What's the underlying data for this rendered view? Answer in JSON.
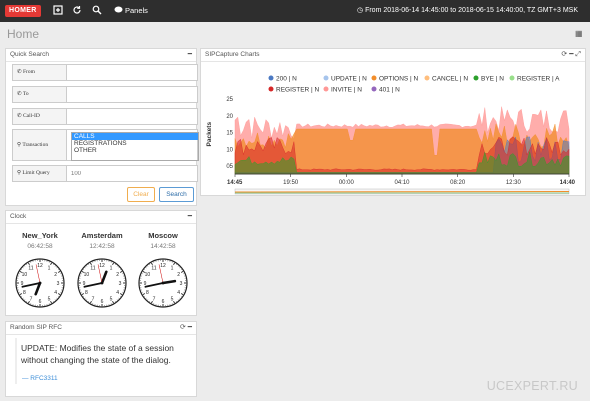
{
  "topbar": {
    "logo": "HOMER",
    "panels_label": "Panels",
    "time_range": "From 2018-06-14 14:45:00 to 2018-06-15 14:40:00, TZ GMT+3 MSK"
  },
  "page_title": "Home",
  "quick_search": {
    "title": "Quick Search",
    "fields": [
      {
        "label": "From",
        "value": ""
      },
      {
        "label": "To",
        "value": ""
      },
      {
        "label": "Call-ID",
        "value": ""
      }
    ],
    "transaction_label": "Transaction",
    "transaction_options": [
      "CALLS",
      "REGISTRATIONS",
      "OTHER"
    ],
    "transaction_selected": "CALLS",
    "limit_label": "Limit Query",
    "limit_placeholder": "100",
    "clear_label": "Clear",
    "search_label": "Search"
  },
  "clock": {
    "title": "Clock",
    "cities": [
      {
        "name": "New_York",
        "time": "06:42:58"
      },
      {
        "name": "Amsterdam",
        "time": "12:42:58"
      },
      {
        "name": "Moscow",
        "time": "14:42:58"
      }
    ]
  },
  "rfc": {
    "title": "Random SIP RFC",
    "text": "UPDATE: Modifies the state of a session without changing the state of the dialog.",
    "link": "— RFC3311"
  },
  "chart_panel": {
    "title": "SIPCapture Charts"
  },
  "chart_data": {
    "type": "area",
    "ylabel": "Packets",
    "y_ticks": [
      "25",
      "20",
      "15",
      "10",
      "05"
    ],
    "x_ticks": [
      "14:45",
      "19:50",
      "00:00",
      "04:10",
      "08:20",
      "12:30",
      "14:40"
    ],
    "legend": [
      {
        "name": "200 | N",
        "color": "#4b79c3"
      },
      {
        "name": "UPDATE | N",
        "color": "#a6c4ec"
      },
      {
        "name": "OPTIONS | N",
        "color": "#f28e2b"
      },
      {
        "name": "CANCEL | N",
        "color": "#ffbe7d"
      },
      {
        "name": "BYE | N",
        "color": "#2ca02c"
      },
      {
        "name": "REGISTER | A",
        "color": "#98df8a"
      },
      {
        "name": "REGISTER | N",
        "color": "#d62728"
      },
      {
        "name": "INVITE | N",
        "color": "#ff9896"
      },
      {
        "name": "401 | N",
        "color": "#9467bd"
      }
    ]
  },
  "watermark": "UCEXPERT.RU"
}
